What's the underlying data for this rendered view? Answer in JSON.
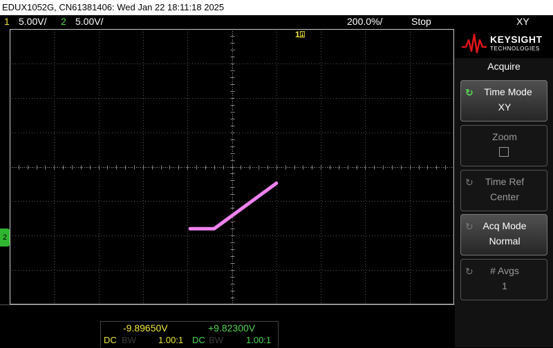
{
  "window": {
    "title": "EDUX1052G, CN61381406: Wed Jan 22 18:11:18 2025"
  },
  "status_bar": {
    "ch1_num": "1",
    "ch1_scale": "5.00V/",
    "ch2_num": "2",
    "ch2_scale": "5.00V/",
    "timebase": "200.0%/",
    "run_state": "Stop",
    "mode": "XY"
  },
  "markers": {
    "trigger": "1",
    "ch2": "2"
  },
  "brand": {
    "name": "KEYSIGHT",
    "sub": "TECHNOLOGIES"
  },
  "menu": {
    "title": "Acquire",
    "softkeys": [
      {
        "label": "Time Mode",
        "value": "XY"
      },
      {
        "label": "Zoom",
        "value": ""
      },
      {
        "label": "Time Ref",
        "value": "Center"
      },
      {
        "label": "Acq Mode",
        "value": "Normal"
      },
      {
        "label": "# Avgs",
        "value": "1"
      }
    ]
  },
  "measurements": {
    "ch1": {
      "value": "-9.89650V",
      "coupling": "DC",
      "bw": "BW",
      "probe": "1.00:1"
    },
    "ch2": {
      "value": "+9.82300V",
      "coupling": "DC",
      "bw": "BW",
      "probe": "1.00:1"
    }
  },
  "colors": {
    "ch1": "#f0e83a",
    "ch2": "#4fd64f",
    "trace": "#ee82ee",
    "grid": "#5a5a5a"
  },
  "trace_points_xy_volts": [
    [
      -4.7,
      -9.0
    ],
    [
      -2.0,
      -9.0
    ],
    [
      5.0,
      -2.4
    ]
  ]
}
